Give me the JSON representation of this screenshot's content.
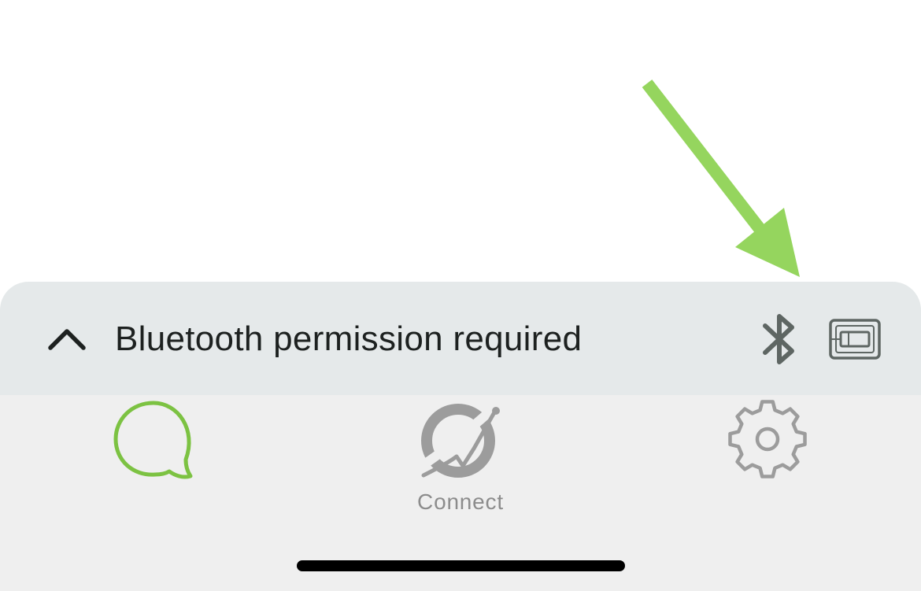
{
  "status_bar": {
    "message": "Bluetooth permission required",
    "icons": [
      "chevron-up-icon",
      "bluetooth-icon",
      "device-icon"
    ],
    "background_color": "#e5e9ea",
    "text_color": "#1d2120",
    "icon_color": "#5e6663"
  },
  "tab_bar": {
    "background_color": "#efefef",
    "active_color": "#7cc242",
    "inactive_color": "#8c8c8c",
    "tabs": [
      {
        "id": "chat",
        "icon": "chat-bubble-icon",
        "label": "",
        "active": true
      },
      {
        "id": "connect",
        "icon": "connect-icon",
        "label": "Connect",
        "active": false
      },
      {
        "id": "settings",
        "icon": "gear-icon",
        "label": "",
        "active": false
      }
    ]
  },
  "annotation": {
    "icon": "arrow-annotation-icon",
    "color": "#95d55e"
  }
}
